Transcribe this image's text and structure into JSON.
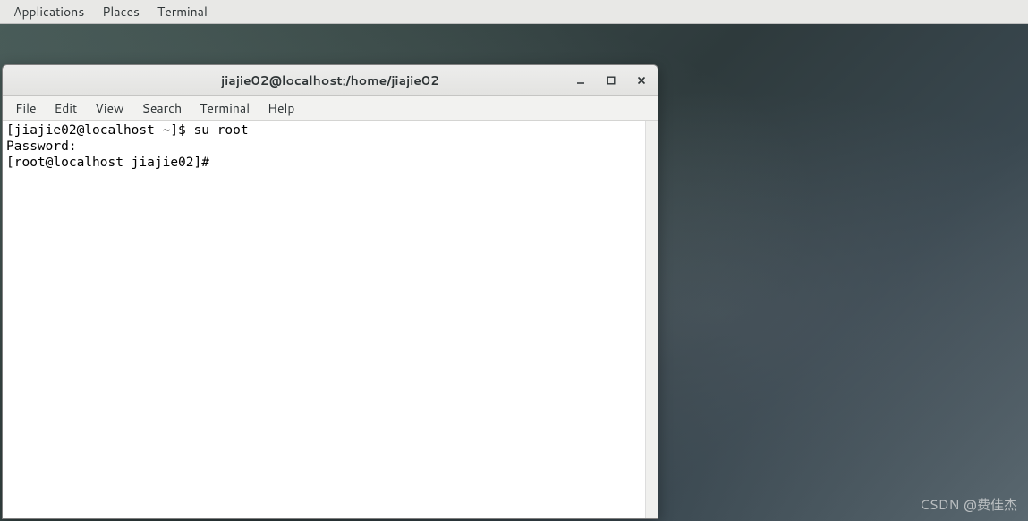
{
  "top_bar": {
    "items": [
      "Applications",
      "Places",
      "Terminal"
    ]
  },
  "window": {
    "title": "jiajie02@localhost:/home/jiajie02",
    "controls": {
      "minimize": "minimize",
      "maximize": "maximize",
      "close": "close"
    }
  },
  "menubar": {
    "items": [
      "File",
      "Edit",
      "View",
      "Search",
      "Terminal",
      "Help"
    ]
  },
  "terminal": {
    "lines": [
      "[jiajie02@localhost ~]$ su root",
      "Password: ",
      "[root@localhost jiajie02]# "
    ]
  },
  "watermark": "CSDN @费佳杰"
}
